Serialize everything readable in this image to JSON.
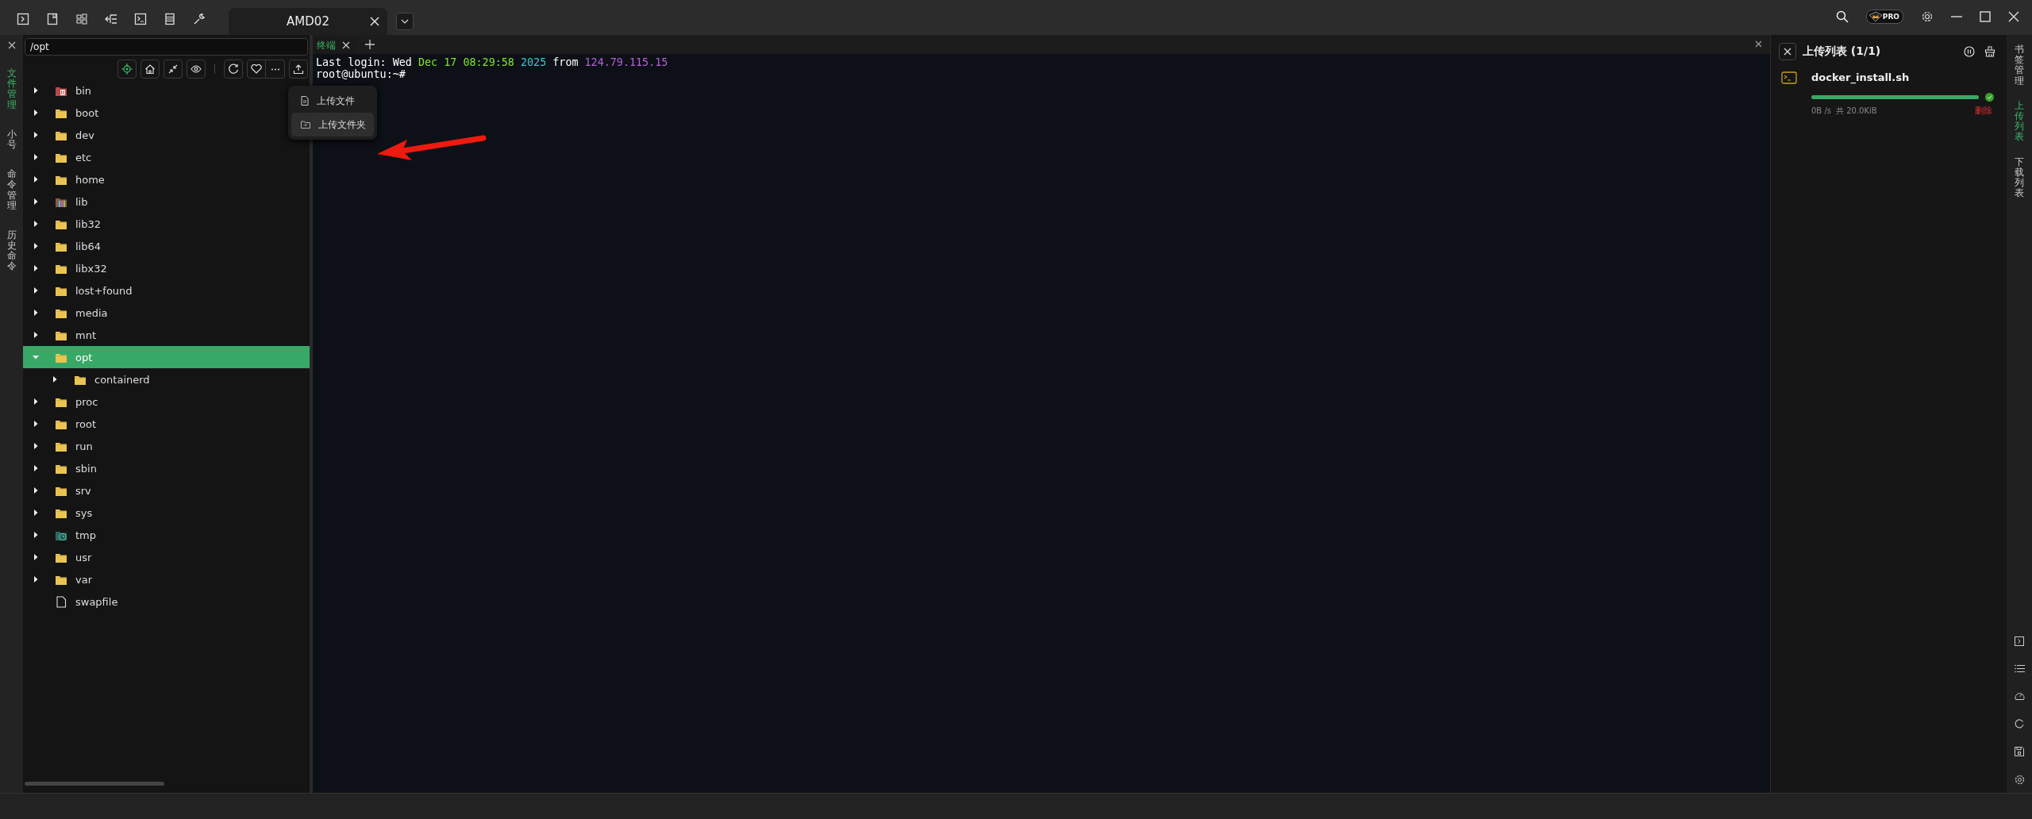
{
  "window": {
    "tab_title": "AMD02",
    "badge": "PRO"
  },
  "left_rail": [
    {
      "label": "文件管理",
      "selected": true
    },
    {
      "label": "小号",
      "selected": false
    },
    {
      "label": "命令管理",
      "selected": false
    },
    {
      "label": "历史命令",
      "selected": false
    }
  ],
  "file_panel": {
    "path": "/opt",
    "menu": [
      {
        "label": "上传文件",
        "kind": "file",
        "selected": false
      },
      {
        "label": "上传文件夹",
        "kind": "folder",
        "selected": true
      }
    ],
    "tree": [
      {
        "name": "bin",
        "kind": "bin",
        "expanded": false,
        "selected": false
      },
      {
        "name": "boot",
        "kind": "folder",
        "expanded": false,
        "selected": false
      },
      {
        "name": "dev",
        "kind": "folder",
        "expanded": false,
        "selected": false
      },
      {
        "name": "etc",
        "kind": "folder",
        "expanded": false,
        "selected": false
      },
      {
        "name": "home",
        "kind": "folder",
        "expanded": false,
        "selected": false
      },
      {
        "name": "lib",
        "kind": "lib",
        "expanded": false,
        "selected": false
      },
      {
        "name": "lib32",
        "kind": "folder",
        "expanded": false,
        "selected": false
      },
      {
        "name": "lib64",
        "kind": "folder",
        "expanded": false,
        "selected": false
      },
      {
        "name": "libx32",
        "kind": "folder",
        "expanded": false,
        "selected": false
      },
      {
        "name": "lost+found",
        "kind": "folder",
        "expanded": false,
        "selected": false
      },
      {
        "name": "media",
        "kind": "folder",
        "expanded": false,
        "selected": false
      },
      {
        "name": "mnt",
        "kind": "folder",
        "expanded": false,
        "selected": false
      },
      {
        "name": "opt",
        "kind": "folder",
        "expanded": true,
        "selected": true,
        "children": [
          {
            "name": "containerd",
            "kind": "folder",
            "expanded": false,
            "selected": false
          }
        ]
      },
      {
        "name": "proc",
        "kind": "folder",
        "expanded": false,
        "selected": false
      },
      {
        "name": "root",
        "kind": "folder",
        "expanded": false,
        "selected": false
      },
      {
        "name": "run",
        "kind": "folder",
        "expanded": false,
        "selected": false
      },
      {
        "name": "sbin",
        "kind": "folder",
        "expanded": false,
        "selected": false
      },
      {
        "name": "srv",
        "kind": "folder",
        "expanded": false,
        "selected": false
      },
      {
        "name": "sys",
        "kind": "folder",
        "expanded": false,
        "selected": false
      },
      {
        "name": "tmp",
        "kind": "tmp",
        "expanded": false,
        "selected": false
      },
      {
        "name": "usr",
        "kind": "folder",
        "expanded": false,
        "selected": false
      },
      {
        "name": "var",
        "kind": "folder",
        "expanded": false,
        "selected": false
      },
      {
        "name": "swapfile",
        "kind": "file",
        "selected": false
      }
    ]
  },
  "terminal": {
    "tabs": [
      {
        "label": "终端",
        "selected": true
      }
    ],
    "lines": [
      [
        {
          "text": "Last login: Wed",
          "color": "#ffffff"
        },
        {
          "text": "Dec 17 08:29:58",
          "color": "#7ee52a"
        },
        {
          "text": "2025",
          "color": "#36c8c8"
        },
        {
          "text": "from",
          "color": "#ffffff"
        },
        {
          "text": "124.79.115.15",
          "color": "#b560d8"
        }
      ],
      [
        {
          "text": "root@ubuntu:~#",
          "color": "#ffffff"
        }
      ]
    ]
  },
  "upload_panel": {
    "title": "上传列表 (1/1)",
    "items": [
      {
        "name": "docker_install.sh",
        "level": 1,
        "done": true,
        "speed": "0B /s",
        "total": "共 20.0KiB",
        "action": "删除"
      }
    ]
  },
  "right_rail": [
    {
      "label": "书签管理",
      "selected": false
    },
    {
      "label": "上传列表",
      "selected": true
    },
    {
      "label": "下载列表",
      "selected": false
    }
  ]
}
